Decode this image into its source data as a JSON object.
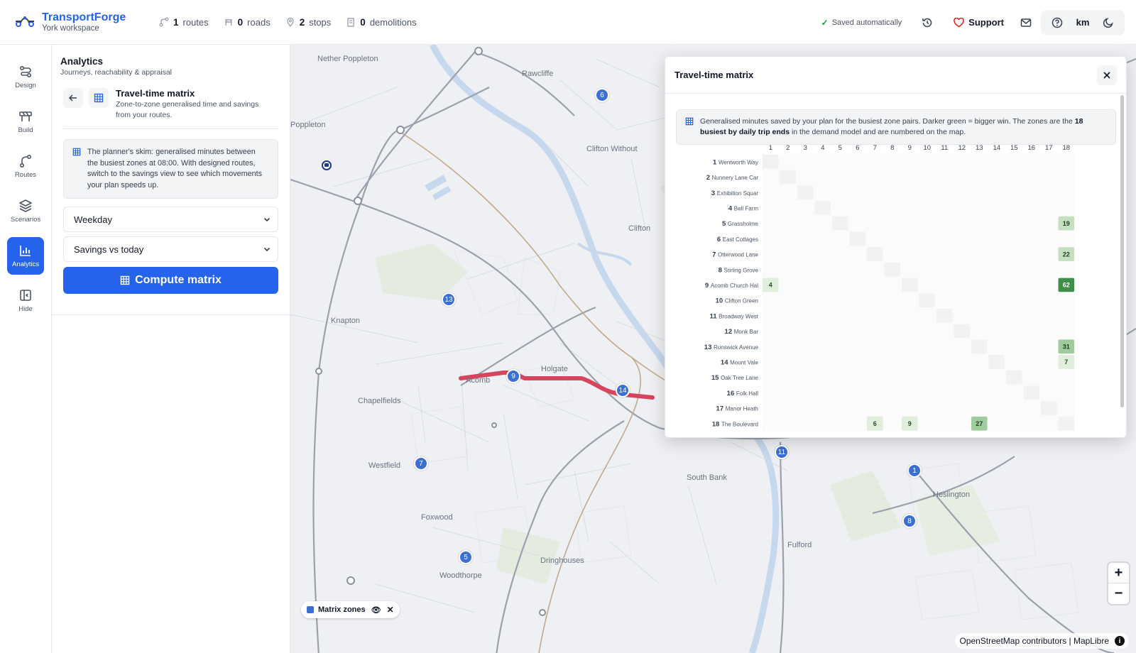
{
  "header": {
    "brand_name": "TransportForge",
    "workspace": "York workspace",
    "stats": [
      {
        "count": "1",
        "label": "routes",
        "icon": "route-icon"
      },
      {
        "count": "0",
        "label": "roads",
        "icon": "road-icon"
      },
      {
        "count": "2",
        "label": "stops",
        "icon": "pin-icon"
      },
      {
        "count": "0",
        "label": "demolitions",
        "icon": "building-icon"
      }
    ],
    "saved_status": "Saved automatically",
    "support_label": "Support",
    "units_label": "km"
  },
  "rail": {
    "items": [
      {
        "label": "Design",
        "icon": "design-icon",
        "active": false
      },
      {
        "label": "Build",
        "icon": "build-icon",
        "active": false
      },
      {
        "label": "Routes",
        "icon": "routes-icon",
        "active": false
      },
      {
        "label": "Scenarios",
        "icon": "layers-icon",
        "active": false
      },
      {
        "label": "Analytics",
        "icon": "chart-icon",
        "active": true
      },
      {
        "label": "Hide",
        "icon": "sidebar-collapse-icon",
        "active": false
      }
    ]
  },
  "panel": {
    "title": "Analytics",
    "subtitle": "Journeys, reachability & appraisal",
    "tool_title": "Travel-time matrix",
    "tool_desc_1": "Zone-to-zone generalised time and savings",
    "tool_desc_2": "from your routes.",
    "info_lines": [
      "The planner's skim: generalised minutes between",
      "the busiest zones at 08:00. With designed routes,",
      "switch to the savings view to see which movements",
      "your plan speeds up."
    ],
    "day_select": "Weekday",
    "view_select": "Savings vs today",
    "compute_label": "Compute matrix"
  },
  "map": {
    "places": [
      {
        "name": "Nether Poppleton"
      },
      {
        "name": "Rawcliffe"
      },
      {
        "name": "Poppleton"
      },
      {
        "name": "Clifton Without"
      },
      {
        "name": "Clifton"
      },
      {
        "name": "Knapton"
      },
      {
        "name": "Holgate"
      },
      {
        "name": "Acomb"
      },
      {
        "name": "Chapelfields"
      },
      {
        "name": "Westfield"
      },
      {
        "name": "Foxwood"
      },
      {
        "name": "Woodthorpe"
      },
      {
        "name": "Dringhouses"
      },
      {
        "name": "South Bank"
      },
      {
        "name": "Fulford"
      },
      {
        "name": "Heslington"
      }
    ],
    "zone_pins": [
      "6",
      "13",
      "9",
      "14",
      "7",
      "5",
      "11",
      "1",
      "8"
    ],
    "legend_label": "Matrix zones",
    "attribution": "OpenStreetMap contributors | MapLibre",
    "accent_route_color": "#d6455d",
    "zone_color": "#3b6fd4"
  },
  "matrix": {
    "title": "Travel-time matrix",
    "note_part1": "Generalised minutes saved by your plan for the busiest zone pairs. Darker green = bigger win. The zones are the",
    "note_bold": "18 busiest by daily trip ends",
    "note_part2": "in the demand model and are numbered on the map.",
    "columns": [
      "1",
      "2",
      "3",
      "4",
      "5",
      "6",
      "7",
      "8",
      "9",
      "10",
      "11",
      "12",
      "13",
      "14",
      "15",
      "16",
      "17",
      "18"
    ],
    "rows": [
      {
        "num": "1",
        "name": "Wentworth Way"
      },
      {
        "num": "2",
        "name": "Nunnery Lane Car"
      },
      {
        "num": "3",
        "name": "Exhibition Squar"
      },
      {
        "num": "4",
        "name": "Bell Farm"
      },
      {
        "num": "5",
        "name": "Grassholme"
      },
      {
        "num": "6",
        "name": "East Cottages"
      },
      {
        "num": "7",
        "name": "Otterwood Lane"
      },
      {
        "num": "8",
        "name": "Stirling Grove"
      },
      {
        "num": "9",
        "name": "Acomb Church Hal"
      },
      {
        "num": "10",
        "name": "Clifton Green"
      },
      {
        "num": "11",
        "name": "Broadway West"
      },
      {
        "num": "12",
        "name": "Monk Bar"
      },
      {
        "num": "13",
        "name": "Runswick Avenue"
      },
      {
        "num": "14",
        "name": "Mount Vale"
      },
      {
        "num": "15",
        "name": "Oak Tree Lane"
      },
      {
        "num": "16",
        "name": "Folk Hall"
      },
      {
        "num": "17",
        "name": "Manor Heath"
      },
      {
        "num": "18",
        "name": "The Boulevard"
      }
    ],
    "cells": [
      {
        "row": 5,
        "col": 18,
        "value": 19
      },
      {
        "row": 7,
        "col": 18,
        "value": 22
      },
      {
        "row": 9,
        "col": 1,
        "value": 4
      },
      {
        "row": 9,
        "col": 18,
        "value": 62
      },
      {
        "row": 13,
        "col": 18,
        "value": 31
      },
      {
        "row": 14,
        "col": 18,
        "value": 7
      },
      {
        "row": 18,
        "col": 7,
        "value": 6
      },
      {
        "row": 18,
        "col": 9,
        "value": 9
      },
      {
        "row": 18,
        "col": 13,
        "value": 27
      }
    ]
  }
}
